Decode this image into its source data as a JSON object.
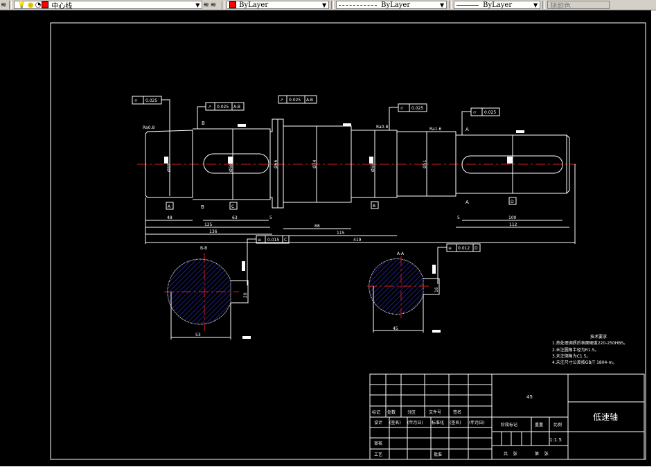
{
  "toolbar": {
    "layer_icons": [
      "layer-manager-icon",
      "bulb-icon",
      "sun-icon",
      "lock-icon"
    ],
    "layer_name": "中心线",
    "layer_color": "#ff0000",
    "color_value": "ByLayer",
    "linetype_value": "ByLayer",
    "lineweight_value": "ByLayer",
    "plotstyle_value": "随颜色"
  },
  "drawing": {
    "gdt": {
      "f1": "0.025",
      "f2": "0.025",
      "f2_datum": "A-B",
      "f3": "0.025",
      "f3_datum": "A-B",
      "f4": "0.025",
      "f5": "0.025",
      "f6": "0.015",
      "f6_datum": "C",
      "f7": "0.012",
      "f7_datum": "D"
    },
    "datums": {
      "a": "A",
      "b": "B",
      "c": "C",
      "d": "D",
      "e": "B",
      "f": "A"
    },
    "roughness": {
      "r1": "Ra0.8",
      "r2": "Ra0.8",
      "r3": "Ra1.6"
    },
    "diameters": {
      "d1": "Ø55",
      "d2": "Ø58",
      "d3": "Ø66",
      "d4": "Ø74",
      "d5": "Ø55",
      "d6": "Ø51"
    },
    "dims": {
      "d48": "48",
      "d63": "63",
      "d5a": "5",
      "d125": "125",
      "d136": "136",
      "d68": "68",
      "d115": "115",
      "d419": "419",
      "d5b": "5",
      "d100": "100",
      "d112": "112",
      "s_bb_w": "53",
      "s_bb_k": "20",
      "s_aa_w": "45",
      "s_aa_k": "16"
    },
    "sections": {
      "bb": "B-B",
      "aa": "A-A"
    },
    "centerline_color": "#d21a1a",
    "hatch_color": "#1a1a8c"
  },
  "tech_requirements": {
    "title": "技术要求",
    "items": [
      "1.热处理调质后表面硬度220-250HBS。",
      "2.未注圆角半径为R1.5。",
      "3.未注倒角为C1.5。",
      "4.未注尺寸公差按GB/T 1804-m。"
    ]
  },
  "title_block": {
    "material": "45",
    "part_name": "低速轴",
    "row_labels": [
      "标记",
      "处数",
      "分区",
      "文件号",
      "签名"
    ],
    "design_row": [
      "设计",
      "(签名)",
      "(年月日)",
      "标准化",
      "(签名)",
      "(年月日)"
    ],
    "stage_mark": "阶段标记",
    "weight": "重量",
    "scale_label": "比例",
    "scale_value": "1:1.5",
    "review": "审核",
    "process": "工艺",
    "approve": "批准",
    "sheets": "共    张",
    "sheet_no": "第    张"
  }
}
